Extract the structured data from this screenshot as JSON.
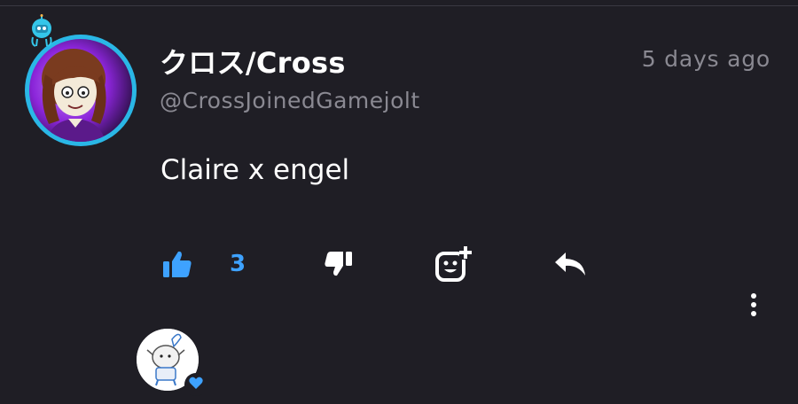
{
  "post": {
    "author": {
      "display_name": "クロス/Cross",
      "username": "@CrossJoinedGamejolt",
      "avatar": "user-avatar-cartoon-girl",
      "ring_color": "#2ab7e6",
      "badge_icon": "robot-sticker-icon"
    },
    "timestamp": "5 days ago",
    "body": "Claire x engel",
    "actions": {
      "like_icon": "thumbs-up-icon",
      "like_count": "3",
      "dislike_icon": "thumbs-down-icon",
      "react_icon": "add-reaction-icon",
      "reply_icon": "reply-arrow-icon",
      "more_icon": "more-vertical-icon"
    },
    "liked_by": {
      "avatar": "user-avatar-white-creature",
      "badge_icon": "heart-icon"
    }
  },
  "colors": {
    "background": "#1f1e25",
    "accent": "#3ea2ff",
    "muted_text": "#8a8992",
    "text": "#ffffff"
  }
}
